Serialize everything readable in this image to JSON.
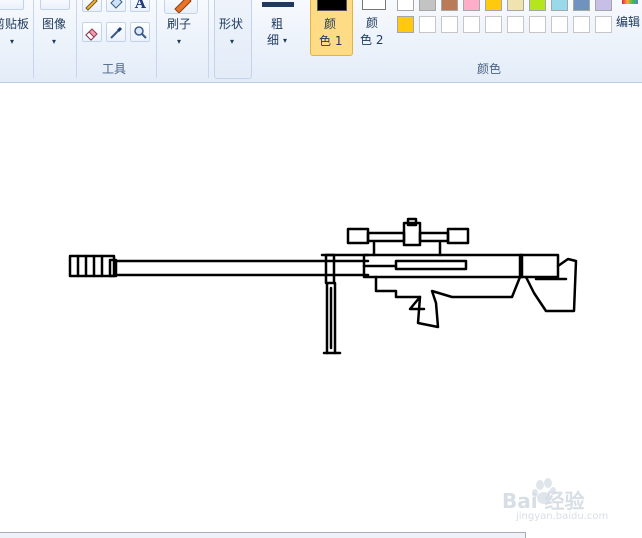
{
  "ribbon": {
    "clipboard_label": "剪贴板",
    "image_label": "图像",
    "tools_label": "工具",
    "text_tool_glyph": "A",
    "brush_label": "刷子",
    "shapes_label": "形状",
    "size_label_1": "粗",
    "size_label_2": "细",
    "color1_label_1": "颜",
    "color1_label_2": "色 1",
    "color2_label_1": "颜",
    "color2_label_2": "色 2",
    "colors_group_label": "颜色",
    "edit_colors_label": "编辑"
  },
  "colors": {
    "color1": "#000000",
    "color2": "#ffffff",
    "palette_row1": [
      "#ffffff",
      "#c3c3c3",
      "#b97a57",
      "#ffaec9",
      "#ffc90e",
      "#efe4b0",
      "#b5e61d",
      "#99d9ea",
      "#7092be",
      "#c8bfe7"
    ],
    "palette_row2": [
      "#ffc90e",
      "#ffffff",
      "#ffffff",
      "#ffffff",
      "#ffffff",
      "#ffffff",
      "#ffffff",
      "#ffffff",
      "#ffffff",
      "#ffffff"
    ],
    "selected_highlight": "#fddc85"
  },
  "watermark": {
    "brand_text": "Bai 经验",
    "url_text": "jingyan.baidu.com"
  }
}
